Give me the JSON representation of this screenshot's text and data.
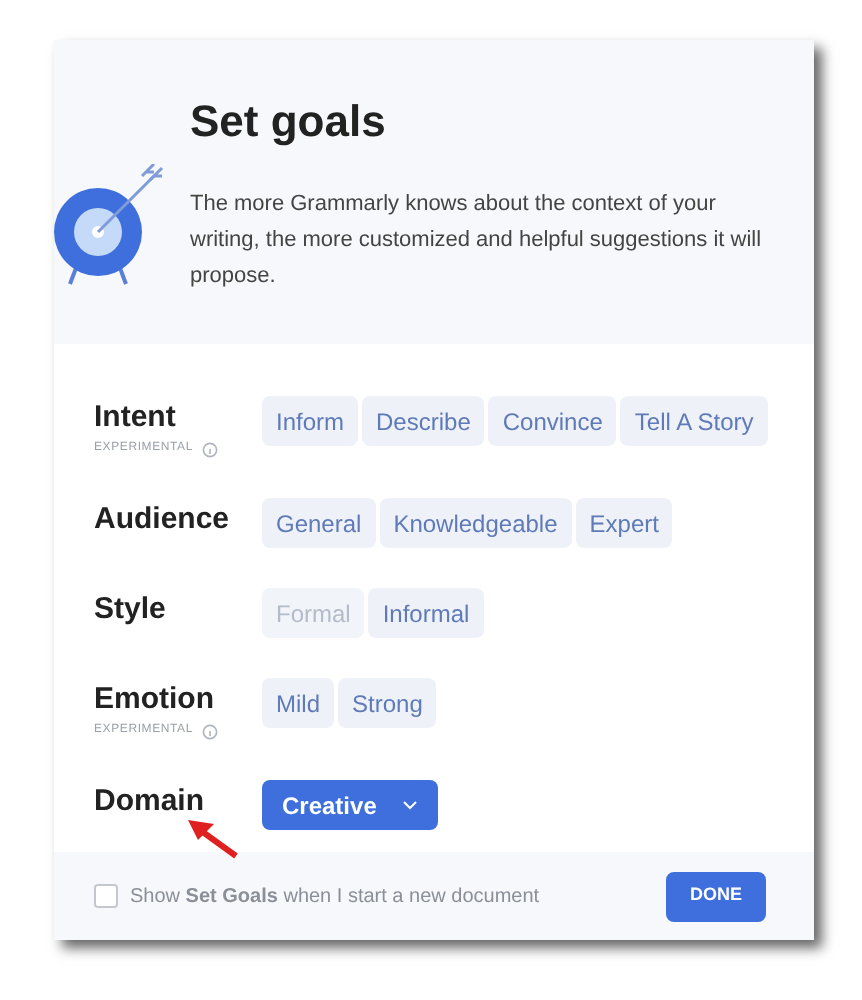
{
  "dialog": {
    "title": "Set goals",
    "description": "The more Grammarly knows about the context of your writing, the more customized and helpful suggestions it will propose."
  },
  "goals": [
    {
      "kind": "chips",
      "label": "Intent",
      "note": "EXPERIMENTAL",
      "options": [
        {
          "label": "Inform",
          "selected": false,
          "disabled": false
        },
        {
          "label": "Describe",
          "selected": false,
          "disabled": false
        },
        {
          "label": "Convince",
          "selected": false,
          "disabled": false
        },
        {
          "label": "Tell A Story",
          "selected": false,
          "disabled": false
        }
      ]
    },
    {
      "kind": "chips",
      "label": "Audience",
      "options": [
        {
          "label": "General",
          "selected": false,
          "disabled": false
        },
        {
          "label": "Knowledgeable",
          "selected": false,
          "disabled": false
        },
        {
          "label": "Expert",
          "selected": false,
          "disabled": false
        }
      ]
    },
    {
      "kind": "chips",
      "label": "Style",
      "options": [
        {
          "label": "Formal",
          "selected": false,
          "disabled": true
        },
        {
          "label": "Informal",
          "selected": false,
          "disabled": false
        }
      ]
    },
    {
      "kind": "chips",
      "label": "Emotion",
      "note": "EXPERIMENTAL",
      "options": [
        {
          "label": "Mild",
          "selected": false,
          "disabled": false
        },
        {
          "label": "Strong",
          "selected": false,
          "disabled": false
        }
      ]
    },
    {
      "kind": "dropdown",
      "label": "Domain",
      "value": "Creative"
    }
  ],
  "footer": {
    "checkbox": {
      "label": "Show **Set Goals** when I start a new document",
      "checked": false
    },
    "button": "DONE"
  }
}
